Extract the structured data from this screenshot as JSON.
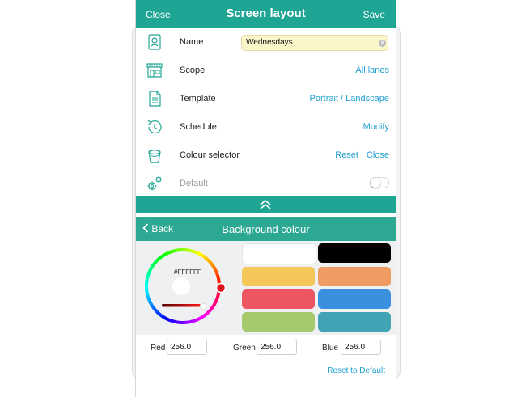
{
  "header": {
    "close_label": "Close",
    "title": "Screen layout",
    "save_label": "Save"
  },
  "settings": {
    "name": {
      "label": "Name",
      "value": "Wednesdays"
    },
    "scope": {
      "label": "Scope",
      "value": "All lanes"
    },
    "template": {
      "label": "Template",
      "value": "Portrait / Landscape"
    },
    "schedule": {
      "label": "Schedule",
      "action": "Modify"
    },
    "colour_selector": {
      "label": "Colour selector",
      "reset": "Reset",
      "close": "Close"
    },
    "default": {
      "label": "Default",
      "toggle_on": false
    }
  },
  "colour_panel": {
    "back_label": "Back",
    "title": "Background colour",
    "hex": "#FFFFFF",
    "swatches": [
      "#ffffff",
      "#000000",
      "#f4c75a",
      "#ef9c63",
      "#ee5563",
      "#3b8fdf",
      "#a6ca6b",
      "#41a3b3"
    ],
    "red_label": "Red",
    "red_value": "256.0",
    "green_label": "Green",
    "green_value": "256.0",
    "blue_label": "Blue",
    "blue_value": "256.0",
    "reset_default": "Reset to Default"
  },
  "colors": {
    "accent": "#1fa594",
    "link": "#1e9fd0",
    "name_field": "#fbf6c9"
  }
}
